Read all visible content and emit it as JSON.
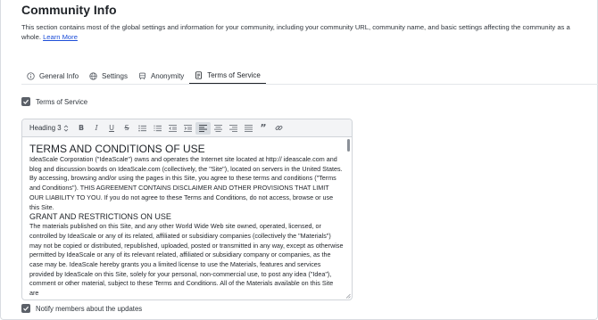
{
  "page": {
    "title": "Community Info",
    "description": "This section contains most of the global settings and information for your community, including your community URL, community name, and basic settings affecting the community as a whole.",
    "learn_more": "Learn More"
  },
  "tabs": [
    {
      "label": "General Info",
      "icon": "info-circle-icon"
    },
    {
      "label": "Settings",
      "icon": "globe-icon"
    },
    {
      "label": "Anonymity",
      "icon": "car-icon"
    },
    {
      "label": "Terms of Service",
      "icon": "document-icon",
      "active": true
    }
  ],
  "tos_checkbox": {
    "label": "Terms of Service",
    "checked": true
  },
  "notify_checkbox": {
    "label": "Notify members about the updates",
    "checked": true
  },
  "editor": {
    "heading_select": "Heading 3",
    "toolbar_icons": [
      "bold-icon",
      "italic-icon",
      "underline-icon",
      "strikethrough-icon",
      "bullet-list-icon",
      "numbered-list-icon",
      "outdent-icon",
      "indent-icon",
      "align-left-icon",
      "align-center-icon",
      "align-right-icon",
      "align-justify-icon",
      "quote-icon",
      "link-icon"
    ],
    "active_tool": "align-left-icon",
    "heading1": "TERMS AND CONDITIONS OF USE",
    "para1": "IdeaScale Corporation (\"IdeaScale\") owns and operates the Internet site located at http:// ideascale.com and blog and discussion boards on IdeaScale.com (collectively, the \"Site\"), located on servers in the United States. By accessing, browsing and/or using the pages in this Site, you agree to these terms and conditions (\"Terms and Conditions\"). THIS AGREEMENT CONTAINS DISCLAIMER AND OTHER PROVISIONS THAT LIMIT OUR LIABILITY TO YOU. If you do not agree to these Terms and Conditions, do not access, browse or use this Site.",
    "heading2": "GRANT AND RESTRICTIONS ON USE",
    "para2": "The materials published on this Site, and any other World Wide Web site owned, operated, licensed, or controlled by IdeaScale or any of its related, affiliated or subsidiary companies (collectively the \"Materials\") may not be copied or distributed, republished, uploaded, posted or transmitted in any way, except as otherwise permitted by IdeaScale or any of its relevant related, affiliated or subsidiary company or companies, as the case may be. IdeaScale hereby grants you a limited license to use the Materials, features and services provided by IdeaScale on this Site, solely for your personal, non-commercial use, to post any idea (\"Idea\"), comment or other material, subject to these Terms and Conditions. All of the Materials available on this Site are"
  }
}
